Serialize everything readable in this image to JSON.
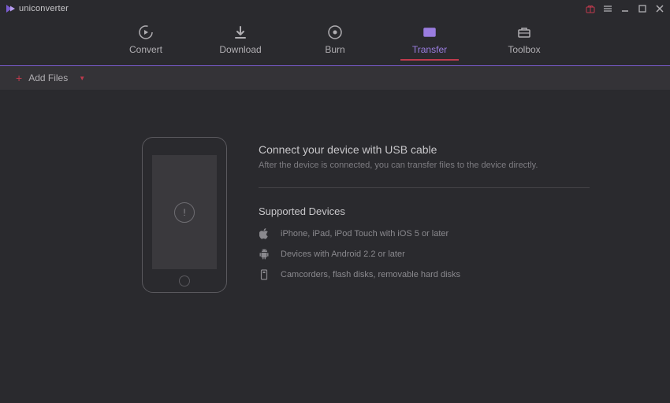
{
  "app": {
    "name": "uniconverter"
  },
  "tabs": {
    "convert": "Convert",
    "download": "Download",
    "burn": "Burn",
    "transfer": "Transfer",
    "toolbox": "Toolbox",
    "active": "transfer"
  },
  "toolbar": {
    "add_files": "Add Files"
  },
  "main": {
    "heading": "Connect your device with USB cable",
    "subtext": "After the device is connected, you can transfer files to the device directly.",
    "supported_title": "Supported Devices",
    "devices": {
      "ios": "iPhone, iPad, iPod Touch with iOS 5 or later",
      "android": "Devices with Android 2.2 or later",
      "storage": "Camcorders, flash disks, removable hard disks"
    }
  }
}
